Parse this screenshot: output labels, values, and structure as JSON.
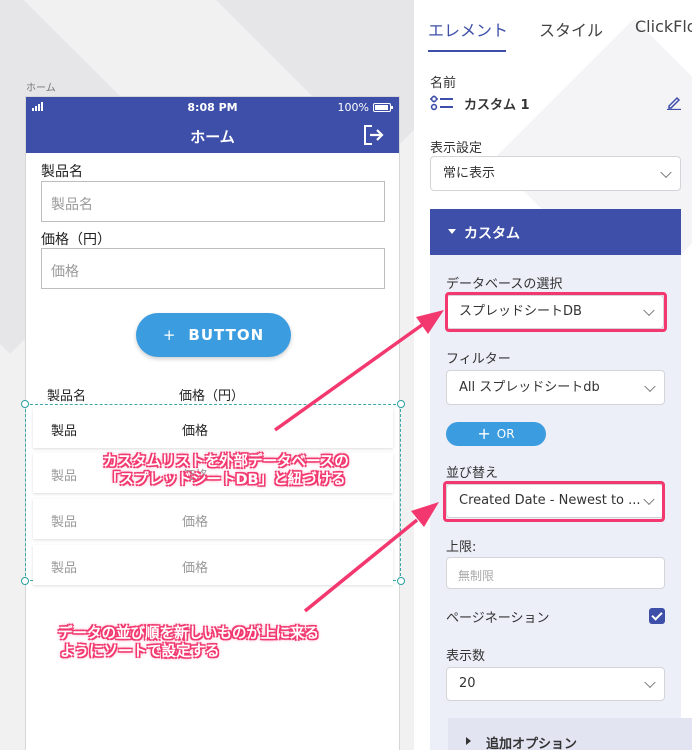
{
  "canvas": {
    "screen_label": "ホーム",
    "statusbar": {
      "time": "8:08 PM",
      "battery": "100%"
    },
    "navbar": {
      "title": "ホーム"
    },
    "form": {
      "product_label": "製品名",
      "product_placeholder": "製品名",
      "price_label": "価格（円）",
      "price_placeholder": "価格"
    },
    "button": {
      "icon": "plus-icon",
      "label": "BUTTON"
    },
    "list": {
      "columns": [
        "製品名",
        "価格（円）"
      ],
      "rows": [
        [
          "製品",
          "価格"
        ],
        [
          "製品",
          "価格"
        ],
        [
          "製品",
          "価格"
        ],
        [
          "製品",
          "価格"
        ]
      ]
    }
  },
  "panel": {
    "tabs": [
      {
        "label": "エレメント",
        "active": true
      },
      {
        "label": "スタイル",
        "active": false
      },
      {
        "label": "ClickFlo",
        "active": false
      }
    ],
    "name_label": "名前",
    "element_name": "カスタム 1",
    "element_icon": "list-icon",
    "visibility_label": "表示設定",
    "visibility_value": "常に表示",
    "custom": {
      "header": "カスタム",
      "db_label": "データベースの選択",
      "db_value": "スプレッドシートDB",
      "filter_label": "フィルター",
      "filter_value": "All スプレッドシートdb",
      "or_label": "OR",
      "sort_label": "並び替え",
      "sort_value": "Created Date - Newest to ...",
      "limit_label": "上限:",
      "limit_placeholder": "無制限",
      "pagination_label": "ページネーション",
      "pagination_checked": true,
      "per_page_label": "表示数",
      "per_page_value": "20",
      "extra_options": "追加オプション"
    }
  },
  "annotations": {
    "callout_1": [
      "カスタムリストを外部データベースの",
      "「スプレッドシートDB」と紐づける"
    ],
    "callout_2": [
      "データの並び順を新しいものが上に来る",
      "ようにソートで設定する"
    ],
    "highlight_color": "#f2386e"
  },
  "colors": {
    "primary": "#3d4fa8",
    "accent": "#3b9de0",
    "annotation": "#f2386e"
  }
}
